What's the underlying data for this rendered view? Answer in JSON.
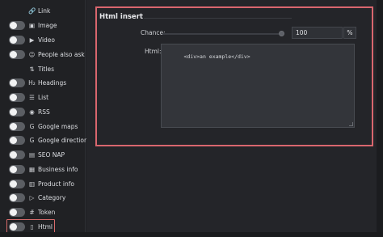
{
  "sidebar": {
    "items": [
      {
        "label": "Link",
        "icon": "link-icon",
        "glyph": "🔗",
        "toggle": false
      },
      {
        "label": "Image",
        "icon": "image-icon",
        "glyph": "▣",
        "toggle": true
      },
      {
        "label": "Video",
        "icon": "video-icon",
        "glyph": "▶",
        "toggle": true
      },
      {
        "label": "People also ask",
        "icon": "people-icon",
        "glyph": "☺",
        "toggle": true
      },
      {
        "label": "Titles",
        "icon": "titles-icon",
        "glyph": "⇅",
        "toggle": false
      },
      {
        "label": "Headings",
        "icon": "headings-icon",
        "glyph": "H₂",
        "toggle": true
      },
      {
        "label": "List",
        "icon": "list-icon",
        "glyph": "☰",
        "toggle": true
      },
      {
        "label": "RSS",
        "icon": "rss-icon",
        "glyph": "◉",
        "toggle": true
      },
      {
        "label": "Google maps",
        "icon": "google-icon",
        "glyph": "G",
        "toggle": true
      },
      {
        "label": "Google direction",
        "icon": "google-icon",
        "glyph": "G",
        "toggle": true
      },
      {
        "label": "SEO NAP",
        "icon": "seo-nap-icon",
        "glyph": "▤",
        "toggle": true
      },
      {
        "label": "Business info",
        "icon": "business-icon",
        "glyph": "▦",
        "toggle": true
      },
      {
        "label": "Product info",
        "icon": "product-icon",
        "glyph": "▥",
        "toggle": true
      },
      {
        "label": "Category",
        "icon": "category-icon",
        "glyph": "▷",
        "toggle": true
      },
      {
        "label": "Token",
        "icon": "token-icon",
        "glyph": "#",
        "toggle": true
      },
      {
        "label": "Html",
        "icon": "html-icon",
        "glyph": "▯",
        "toggle": true
      }
    ]
  },
  "panel": {
    "title": "Html insert",
    "chance_label": "Chance:",
    "chance_value": "100",
    "chance_unit": "%",
    "html_label": "Html:",
    "html_value": "<div>an example</div>"
  },
  "colors": {
    "highlight": "#d9666e",
    "background": "#242529",
    "sidebar": "#202124"
  }
}
